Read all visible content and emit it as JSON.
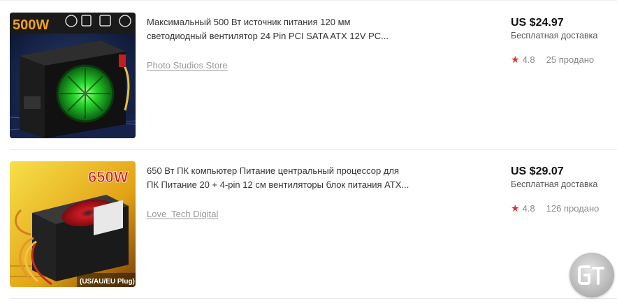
{
  "products": [
    {
      "title_line1": "Максимальный 500 Вт источник питания 120 мм",
      "title_line2": "светодиодный вентилятор 24 Pin PCI SATA ATX 12V PC...",
      "store": "Photo Studios Store",
      "price": "US $24.97",
      "shipping": "Бесплатная доставка",
      "rating": "4.8",
      "sold": "25 продано",
      "image": {
        "wattage": "500W",
        "features": [
          "Switchable Voltage",
          "Double Tube",
          "Topless",
          "12cm LED Fan"
        ],
        "led_color": "#22d42a"
      }
    },
    {
      "title_line1": "650 Вт ПК компьютер Питание центральный процессор для",
      "title_line2": "ПК Питание 20 + 4-pin 12 см вентиляторы блок питания ATX...",
      "store": "Love  Tech Digital",
      "price": "US $29.07",
      "shipping": "Бесплатная доставка",
      "rating": "4.8",
      "sold": "126 продано",
      "image": {
        "wattage": "650W",
        "plug": "(US/AU/EU Plug)",
        "fan_color": "#c3121b"
      }
    }
  ],
  "floating_button": {
    "label": "Gt",
    "icon": "gt-logo-icon"
  },
  "colors": {
    "star": "#e43226",
    "price": "#111111",
    "muted": "#999999"
  }
}
